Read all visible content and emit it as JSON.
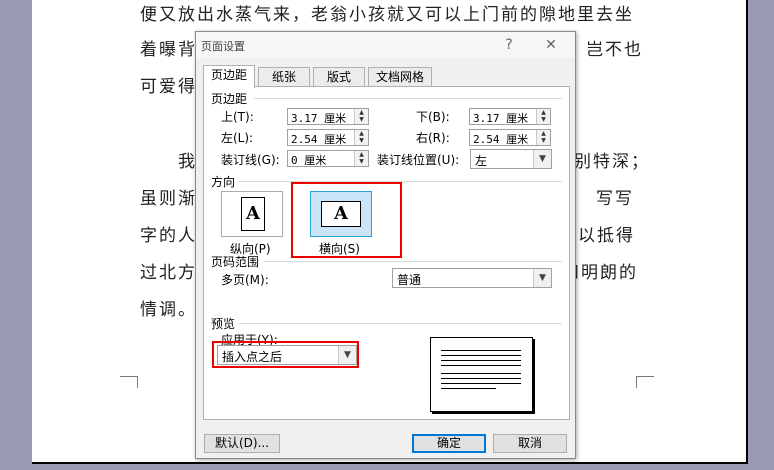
{
  "document": {
    "lines": [
      "便又放出水蒸气来，老翁小孩就又可以上门前的隙地里去坐",
      "着曝背",
      "岂不也",
      "可爱得",
      "我",
      "别特深；",
      "虽则渐",
      "写写",
      "字的人",
      "以抵得",
      "过北方",
      "和明朗的",
      "情调。"
    ]
  },
  "dialog": {
    "title": "页面设置",
    "help": "?",
    "close": "✕",
    "tabs": [
      "页边距",
      "纸张",
      "版式",
      "文档网格"
    ],
    "margins_group": "页边距",
    "top_label": "上(T):",
    "top_value": "3.17 厘米",
    "bottom_label": "下(B):",
    "bottom_value": "3.17 厘米",
    "left_label": "左(L):",
    "left_value": "2.54 厘米",
    "right_label": "右(R):",
    "right_value": "2.54 厘米",
    "gutter_label": "装订线(G):",
    "gutter_value": "0 厘米",
    "gutter_pos_label": "装订线位置(U):",
    "gutter_pos_value": "左",
    "orientation_group": "方向",
    "portrait_label": "纵向(P)",
    "landscape_label": "横向(S)",
    "orientation_glyph": "A",
    "pages_group": "页码范围",
    "multiple_pages_label": "多页(M):",
    "multiple_pages_value": "普通",
    "preview_group": "预览",
    "apply_to_label": "应用于(Y):",
    "apply_to_value": "插入点之后",
    "default_button": "默认(D)...",
    "ok_button": "确定",
    "cancel_button": "取消",
    "highlight_color": "#e00000",
    "selection_color": "#cce4f7"
  }
}
